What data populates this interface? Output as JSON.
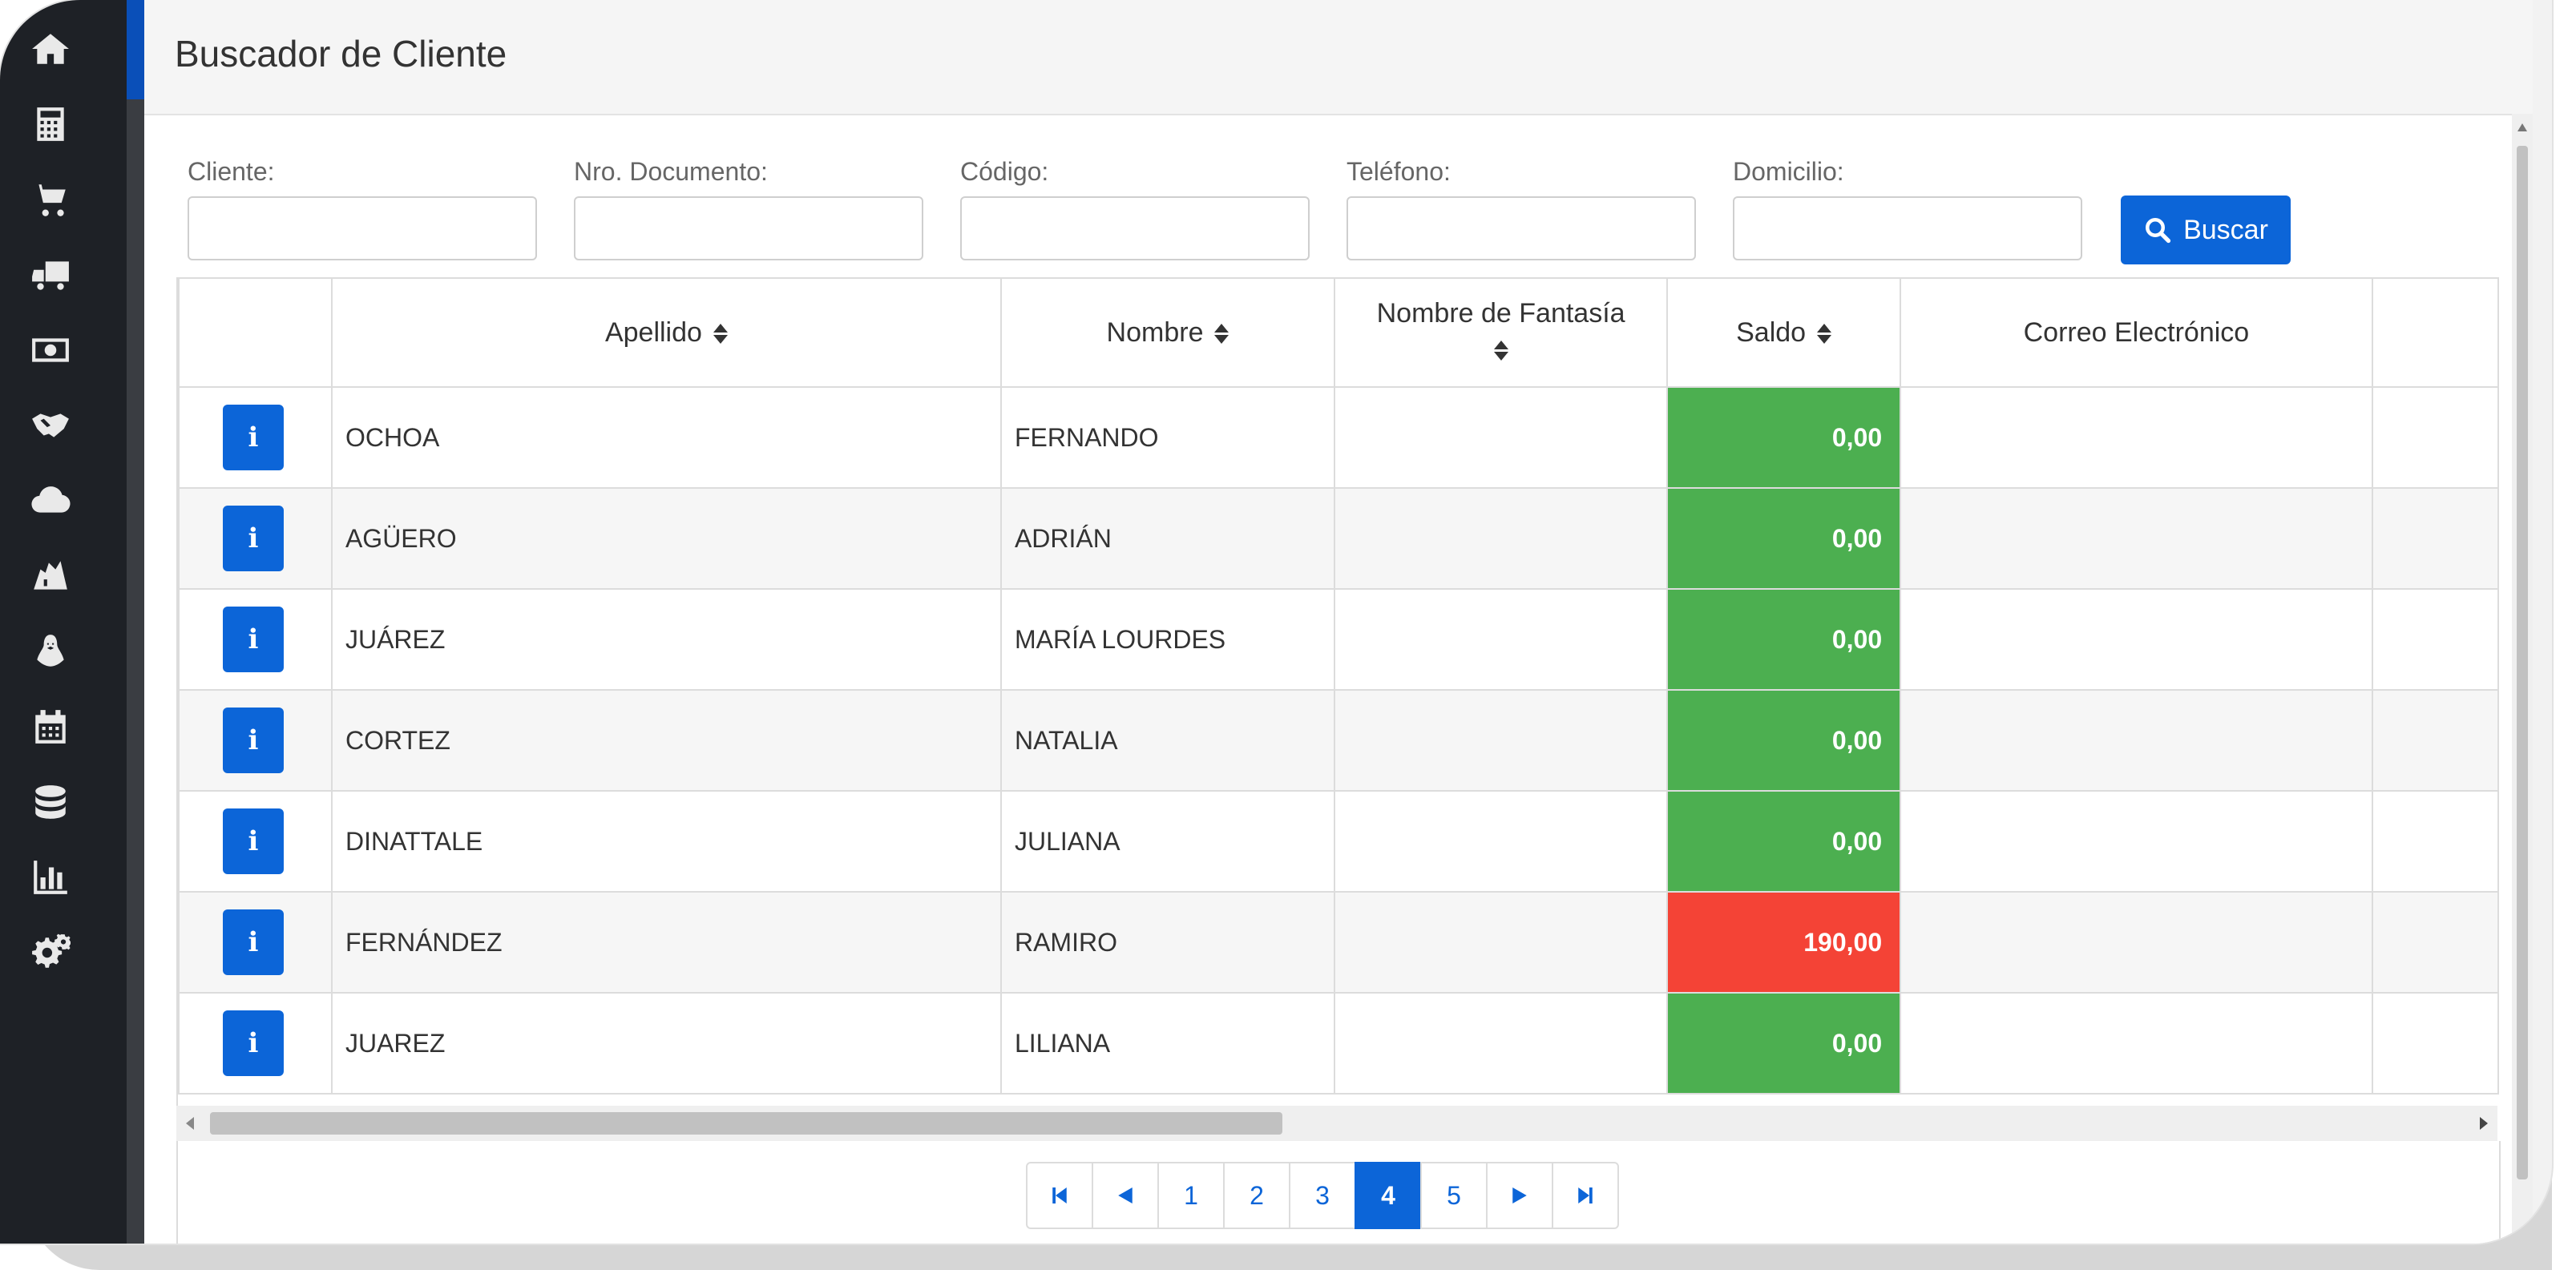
{
  "page": {
    "title": "Buscador de Cliente"
  },
  "sidebar": {
    "icons": [
      "home-icon",
      "calculator-icon",
      "shopping-cart-icon",
      "truck-icon",
      "money-icon",
      "handshake-icon",
      "cloud-icon",
      "store-icon",
      "linux-icon",
      "calendar-icon",
      "database-icon",
      "bar-chart-icon",
      "gears-icon"
    ]
  },
  "filters": {
    "cliente_label": "Cliente:",
    "documento_label": "Nro. Documento:",
    "codigo_label": "Código:",
    "telefono_label": "Teléfono:",
    "domicilio_label": "Domicilio:",
    "buscar_label": "Buscar"
  },
  "table": {
    "headers": [
      "Apellido",
      "Nombre",
      "Nombre de Fantasía",
      "Saldo",
      "Correo Electrónico"
    ],
    "rows": [
      {
        "apellido": "OCHOA",
        "nombre": "FERNANDO",
        "fantasia": "",
        "saldo": "0,00",
        "saldo_status": "green"
      },
      {
        "apellido": "AGÜERO",
        "nombre": "ADRIÁN",
        "fantasia": "",
        "saldo": "0,00",
        "saldo_status": "green"
      },
      {
        "apellido": "JUÁREZ",
        "nombre": "MARÍA LOURDES",
        "fantasia": "",
        "saldo": "0,00",
        "saldo_status": "green"
      },
      {
        "apellido": "CORTEZ",
        "nombre": "NATALIA",
        "fantasia": "",
        "saldo": "0,00",
        "saldo_status": "green"
      },
      {
        "apellido": "DINATTALE",
        "nombre": "JULIANA",
        "fantasia": "",
        "saldo": "0,00",
        "saldo_status": "green"
      },
      {
        "apellido": "FERNÁNDEZ",
        "nombre": "RAMIRO",
        "fantasia": "",
        "saldo": "190,00",
        "saldo_status": "red"
      },
      {
        "apellido": "JUAREZ",
        "nombre": "LILIANA",
        "fantasia": "",
        "saldo": "0,00",
        "saldo_status": "green"
      }
    ]
  },
  "pagination": {
    "pages": [
      "1",
      "2",
      "3",
      "4",
      "5"
    ],
    "current": "4"
  },
  "colors": {
    "primary": "#0c65d8",
    "saldo_ok": "#4caf50",
    "saldo_debt": "#f44336",
    "sidebar": "#1e2126"
  }
}
